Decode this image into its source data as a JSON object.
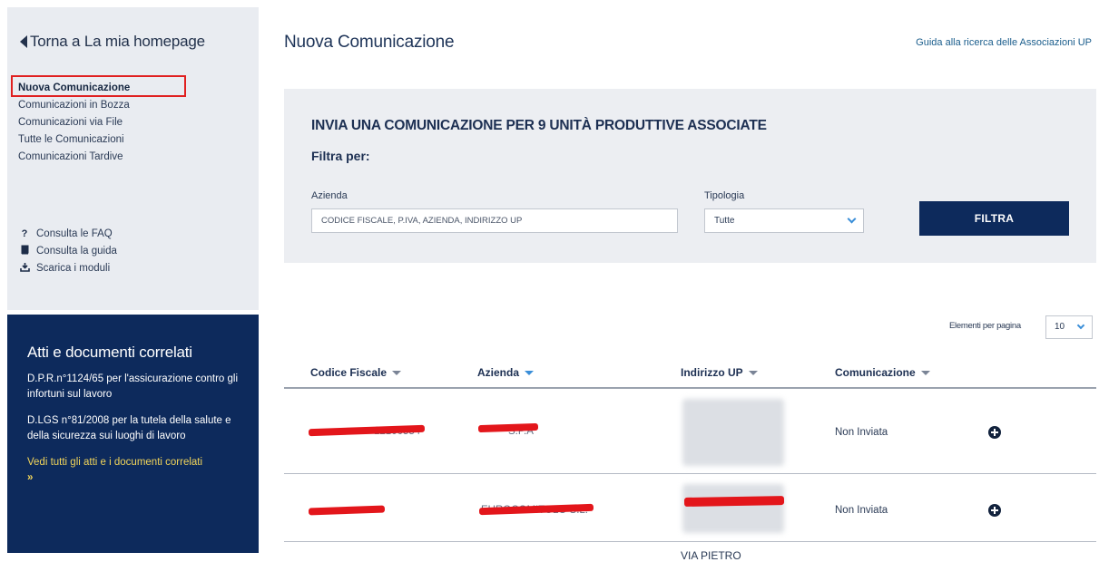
{
  "sidebar": {
    "back_label": "Torna a La mia homepage",
    "nav": [
      {
        "label": "Nuova Comunicazione",
        "active": true
      },
      {
        "label": "Comunicazioni in Bozza"
      },
      {
        "label": "Comunicazioni via File"
      },
      {
        "label": "Tutte le Comunicazioni"
      },
      {
        "label": "Comunicazioni Tardive"
      }
    ],
    "help": [
      {
        "icon": "question-icon",
        "label": "Consulta le FAQ"
      },
      {
        "icon": "book-icon",
        "label": "Consulta la guida"
      },
      {
        "icon": "download-icon",
        "label": "Scarica i moduli"
      }
    ],
    "related": {
      "title": "Atti e documenti correlati",
      "links": [
        "D.P.R.n°1124/65 per l'assicurazione contro gli infortuni sul lavoro",
        "D.LGS n°81/2008 per la tutela della salute e della sicurezza sui luoghi di lavoro"
      ],
      "see_all": "Vedi tutti gli atti e i documenti correlati"
    }
  },
  "header": {
    "title": "Nuova Comunicazione",
    "guide_link": "Guida alla ricerca delle Associazioni UP"
  },
  "filter": {
    "heading": "INVIA UNA COMUNICAZIONE PER 9 UNITÀ PRODUTTIVE ASSOCIATE",
    "filter_label": "Filtra per:",
    "azienda_label": "Azienda",
    "azienda_placeholder": "CODICE FISCALE, P.IVA, AZIENDA, INDIRIZZO UP",
    "tipologia_label": "Tipologia",
    "tipologia_value": "Tutte",
    "button_label": "FILTRA"
  },
  "pagination": {
    "label": "Elementi per pagina",
    "value": "10"
  },
  "table": {
    "columns": [
      "Codice Fiscale",
      "Azienda",
      "Indirizzo UP",
      "Comunicazione"
    ],
    "rows": [
      {
        "codice_fiscale_tail": "12100554",
        "azienda_tail": "S.P.A",
        "comunicazione": "Non Inviata"
      },
      {
        "codice_fiscale_tail": "",
        "azienda_tail": "EUROCOMITOLO S.L.",
        "comunicazione": "Non Inviata"
      }
    ],
    "next_row_address": "VIA PIETRO"
  },
  "colors": {
    "navy": "#0d2a5c",
    "panel": "#eceef2",
    "sidebar": "#e9ecf1",
    "accent_link": "#f2d55a",
    "highlight": "#e02020",
    "redaction": "#e3161b"
  }
}
